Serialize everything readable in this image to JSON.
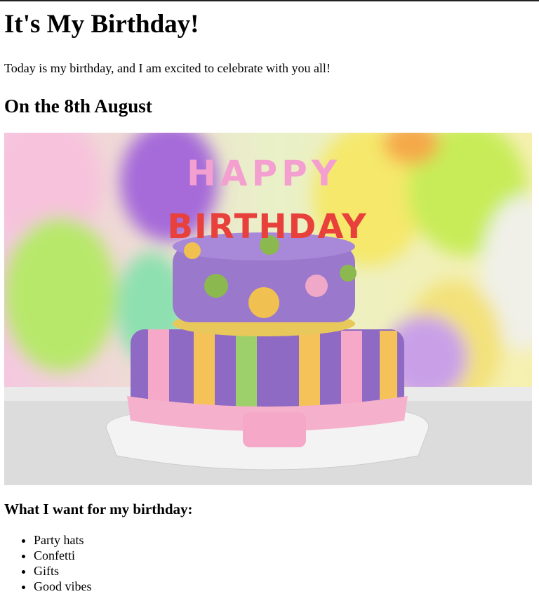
{
  "title": "It's My Birthday!",
  "intro": "Today is my birthday, and I am excited to celebrate with you all!",
  "date_heading": "On the 8th August",
  "image": {
    "alt": "Birthday cake with HAPPY BIRTHDAY candles and balloons",
    "candle_text": [
      "HAPPY",
      "BIRTHDAY"
    ]
  },
  "wishlist_heading": "What I want for my birthday:",
  "wishlist": [
    "Party hats",
    "Confetti",
    "Gifts",
    "Good vibes"
  ]
}
